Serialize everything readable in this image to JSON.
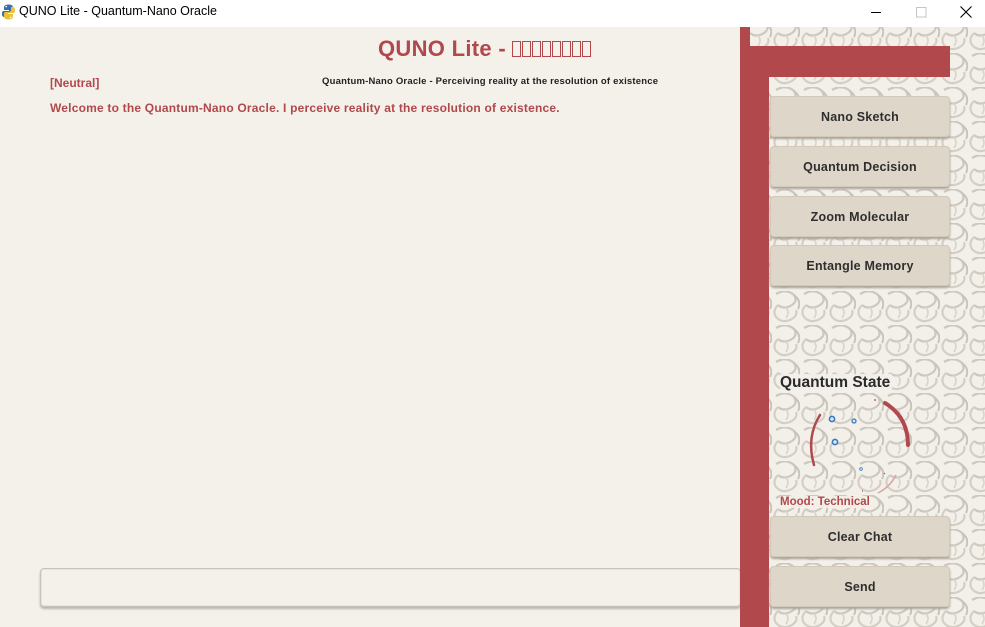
{
  "window": {
    "title": "QUNO Lite - Quantum-Nano Oracle"
  },
  "main": {
    "title_prefix": "QUNO Lite - ",
    "title_missing_glyphs": 8,
    "mood_tag": "[Neutral]",
    "subtitle": "Quantum-Nano Oracle - Perceiving reality at the resolution of existence",
    "messages": [
      "Welcome to the Quantum-Nano Oracle. I perceive reality at the resolution of existence."
    ],
    "input": {
      "value": "",
      "placeholder": ""
    }
  },
  "sidebar": {
    "buttons": [
      {
        "label": "Nano Sketch"
      },
      {
        "label": "Quantum Decision"
      },
      {
        "label": "Zoom Molecular"
      },
      {
        "label": "Entangle Memory"
      }
    ],
    "quantum_state_title": "Quantum State",
    "mood_line": "Mood: Technical",
    "clear_label": "Clear Chat",
    "send_label": "Send"
  },
  "colors": {
    "accent": "#b1484b",
    "background": "#f4f1eb",
    "button": "#ded6c9",
    "particle": "#3a78c0"
  },
  "icons": {
    "app": "python-snake-icon",
    "minimize": "minimize-icon",
    "maximize": "maximize-icon",
    "close": "close-icon"
  }
}
